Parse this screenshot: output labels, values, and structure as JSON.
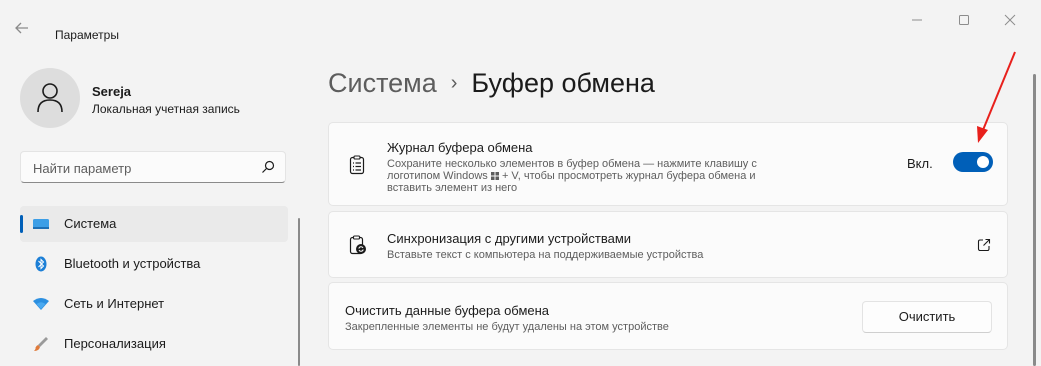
{
  "window": {
    "title": "Параметры",
    "controls": [
      "minimize",
      "maximize",
      "close"
    ]
  },
  "user": {
    "name": "Sereja",
    "account_type": "Локальная учетная запись"
  },
  "search": {
    "placeholder": "Найти параметр",
    "value": ""
  },
  "sidebar": {
    "items": [
      {
        "label": "Система",
        "icon": "system-display-icon",
        "active": true
      },
      {
        "label": "Bluetooth и устройства",
        "icon": "bluetooth-icon",
        "active": false
      },
      {
        "label": "Сеть и Интернет",
        "icon": "wifi-icon",
        "active": false
      },
      {
        "label": "Персонализация",
        "icon": "paintbrush-icon",
        "active": false
      }
    ]
  },
  "breadcrumb": {
    "parent": "Система",
    "separator": "›",
    "current": "Буфер обмена"
  },
  "cards": {
    "history": {
      "title": "Журнал буфера обмена",
      "description_line1": "Сохраните несколько элементов в буфер обмена — нажмите клавишу с",
      "description_line2_a": "логотипом Windows",
      "description_line2_b": "+ V, чтобы просмотреть журнал буфера обмена и",
      "description_line3": "вставить элемент из него",
      "toggle_label": "Вкл.",
      "toggle_on": true,
      "icon": "clipboard-list-icon"
    },
    "sync": {
      "title": "Синхронизация с другими устройствами",
      "description": "Вставьте текст с компьютера на поддерживаемые устройства",
      "icon": "clipboard-sync-icon"
    },
    "clear": {
      "title": "Очистить данные буфера обмена",
      "description": "Закрепленные элементы не будут удалены на этом устройстве",
      "button_label": "Очистить"
    }
  },
  "colors": {
    "accent": "#005fb8",
    "background": "#f3f3f3",
    "card": "#fbfbfb",
    "annotation_arrow": "#e8201c"
  }
}
